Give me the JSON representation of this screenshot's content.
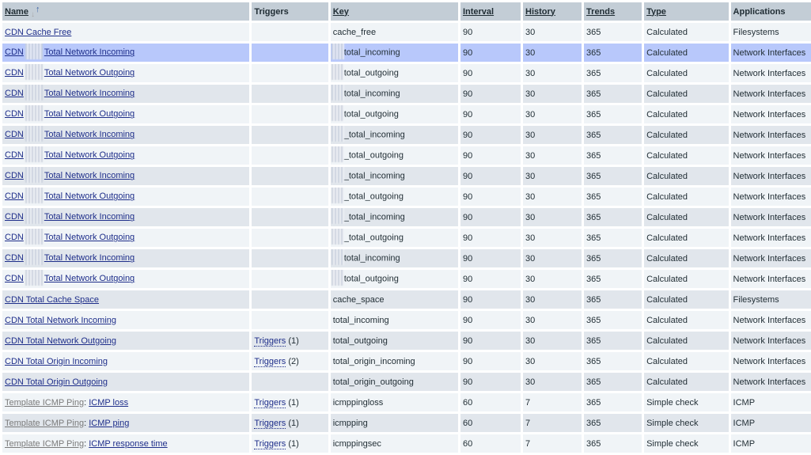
{
  "columns": [
    {
      "label": "Name",
      "sortable": true,
      "sorted": "asc"
    },
    {
      "label": "Triggers",
      "sortable": false
    },
    {
      "label": "Key",
      "sortable": true
    },
    {
      "label": "Interval",
      "sortable": true
    },
    {
      "label": "History",
      "sortable": true
    },
    {
      "label": "Trends",
      "sortable": true
    },
    {
      "label": "Type",
      "sortable": true
    },
    {
      "label": "Applications",
      "sortable": false
    }
  ],
  "icons": {
    "sort_asc": "sort-ascending-arrows-icon"
  },
  "rows": [
    {
      "template": "",
      "name_pre": "CDN Cache Free",
      "redacted": false,
      "name_post": "",
      "triggers": "",
      "trig_count": "",
      "key": "cache_free",
      "key_redacted": false,
      "interval": "90",
      "history": "30",
      "trends": "365",
      "type": "Calculated",
      "app": "Filesystems",
      "highlight": false
    },
    {
      "template": "",
      "name_pre": "CDN",
      "redacted": true,
      "name_post": "Total Network Incoming",
      "triggers": "",
      "trig_count": "",
      "key": "total_incoming",
      "key_redacted": true,
      "interval": "90",
      "history": "30",
      "trends": "365",
      "type": "Calculated",
      "app": "Network Interfaces",
      "highlight": true
    },
    {
      "template": "",
      "name_pre": "CDN",
      "redacted": true,
      "name_post": "Total Network Outgoing",
      "triggers": "",
      "trig_count": "",
      "key": "total_outgoing",
      "key_redacted": true,
      "interval": "90",
      "history": "30",
      "trends": "365",
      "type": "Calculated",
      "app": "Network Interfaces",
      "highlight": false
    },
    {
      "template": "",
      "name_pre": "CDN",
      "redacted": true,
      "name_post": "Total Network Incoming",
      "triggers": "",
      "trig_count": "",
      "key": "total_incoming",
      "key_redacted": true,
      "interval": "90",
      "history": "30",
      "trends": "365",
      "type": "Calculated",
      "app": "Network Interfaces",
      "highlight": false
    },
    {
      "template": "",
      "name_pre": "CDN",
      "redacted": true,
      "name_post": "Total Network Outgoing",
      "triggers": "",
      "trig_count": "",
      "key": "total_outgoing",
      "key_redacted": true,
      "interval": "90",
      "history": "30",
      "trends": "365",
      "type": "Calculated",
      "app": "Network Interfaces",
      "highlight": false
    },
    {
      "template": "",
      "name_pre": "CDN",
      "redacted": true,
      "name_post": "Total Network Incoming",
      "triggers": "",
      "trig_count": "",
      "key": "_total_incoming",
      "key_redacted": true,
      "interval": "90",
      "history": "30",
      "trends": "365",
      "type": "Calculated",
      "app": "Network Interfaces",
      "highlight": false
    },
    {
      "template": "",
      "name_pre": "CDN",
      "redacted": true,
      "name_post": "Total Network Outgoing",
      "triggers": "",
      "trig_count": "",
      "key": "_total_outgoing",
      "key_redacted": true,
      "interval": "90",
      "history": "30",
      "trends": "365",
      "type": "Calculated",
      "app": "Network Interfaces",
      "highlight": false
    },
    {
      "template": "",
      "name_pre": "CDN",
      "redacted": true,
      "name_post": "Total Network Incoming",
      "triggers": "",
      "trig_count": "",
      "key": "_total_incoming",
      "key_redacted": true,
      "interval": "90",
      "history": "30",
      "trends": "365",
      "type": "Calculated",
      "app": "Network Interfaces",
      "highlight": false
    },
    {
      "template": "",
      "name_pre": "CDN",
      "redacted": true,
      "name_post": "Total Network Outgoing",
      "triggers": "",
      "trig_count": "",
      "key": "_total_outgoing",
      "key_redacted": true,
      "interval": "90",
      "history": "30",
      "trends": "365",
      "type": "Calculated",
      "app": "Network Interfaces",
      "highlight": false
    },
    {
      "template": "",
      "name_pre": "CDN",
      "redacted": true,
      "name_post": "Total Network Incoming",
      "triggers": "",
      "trig_count": "",
      "key": "_total_incoming",
      "key_redacted": true,
      "interval": "90",
      "history": "30",
      "trends": "365",
      "type": "Calculated",
      "app": "Network Interfaces",
      "highlight": false
    },
    {
      "template": "",
      "name_pre": "CDN",
      "redacted": true,
      "name_post": "Total Network Outgoing",
      "triggers": "",
      "trig_count": "",
      "key": "_total_outgoing",
      "key_redacted": true,
      "interval": "90",
      "history": "30",
      "trends": "365",
      "type": "Calculated",
      "app": "Network Interfaces",
      "highlight": false
    },
    {
      "template": "",
      "name_pre": "CDN",
      "redacted": true,
      "name_post": "Total Network Incoming",
      "triggers": "",
      "trig_count": "",
      "key": "total_incoming",
      "key_redacted": true,
      "interval": "90",
      "history": "30",
      "trends": "365",
      "type": "Calculated",
      "app": "Network Interfaces",
      "highlight": false
    },
    {
      "template": "",
      "name_pre": "CDN",
      "redacted": true,
      "name_post": "Total Network Outgoing",
      "triggers": "",
      "trig_count": "",
      "key": "total_outgoing",
      "key_redacted": true,
      "interval": "90",
      "history": "30",
      "trends": "365",
      "type": "Calculated",
      "app": "Network Interfaces",
      "highlight": false
    },
    {
      "template": "",
      "name_pre": "CDN Total Cache Space",
      "redacted": false,
      "name_post": "",
      "triggers": "",
      "trig_count": "",
      "key": "cache_space",
      "key_redacted": false,
      "interval": "90",
      "history": "30",
      "trends": "365",
      "type": "Calculated",
      "app": "Filesystems",
      "highlight": false
    },
    {
      "template": "",
      "name_pre": "CDN Total Network Incoming",
      "redacted": false,
      "name_post": "",
      "triggers": "",
      "trig_count": "",
      "key": "total_incoming",
      "key_redacted": false,
      "interval": "90",
      "history": "30",
      "trends": "365",
      "type": "Calculated",
      "app": "Network Interfaces",
      "highlight": false
    },
    {
      "template": "",
      "name_pre": "CDN Total Network Outgoing",
      "redacted": false,
      "name_post": "",
      "triggers": "Triggers",
      "trig_count": "(1)",
      "key": "total_outgoing",
      "key_redacted": false,
      "interval": "90",
      "history": "30",
      "trends": "365",
      "type": "Calculated",
      "app": "Network Interfaces",
      "highlight": false
    },
    {
      "template": "",
      "name_pre": "CDN Total Origin Incoming",
      "redacted": false,
      "name_post": "",
      "triggers": "Triggers",
      "trig_count": "(2)",
      "key": "total_origin_incoming",
      "key_redacted": false,
      "interval": "90",
      "history": "30",
      "trends": "365",
      "type": "Calculated",
      "app": "Network Interfaces",
      "highlight": false
    },
    {
      "template": "",
      "name_pre": "CDN Total Origin Outgoing",
      "redacted": false,
      "name_post": "",
      "triggers": "",
      "trig_count": "",
      "key": "total_origin_outgoing",
      "key_redacted": false,
      "interval": "90",
      "history": "30",
      "trends": "365",
      "type": "Calculated",
      "app": "Network Interfaces",
      "highlight": false
    },
    {
      "template": "Template ICMP Ping",
      "name_pre": "ICMP loss",
      "redacted": false,
      "name_post": "",
      "triggers": "Triggers",
      "trig_count": "(1)",
      "key": "icmppingloss",
      "key_redacted": false,
      "interval": "60",
      "history": "7",
      "trends": "365",
      "type": "Simple check",
      "app": "ICMP",
      "highlight": false
    },
    {
      "template": "Template ICMP Ping",
      "name_pre": "ICMP ping",
      "redacted": false,
      "name_post": "",
      "triggers": "Triggers",
      "trig_count": "(1)",
      "key": "icmpping",
      "key_redacted": false,
      "interval": "60",
      "history": "7",
      "trends": "365",
      "type": "Simple check",
      "app": "ICMP",
      "highlight": false
    },
    {
      "template": "Template ICMP Ping",
      "name_pre": "ICMP response time",
      "redacted": false,
      "name_post": "",
      "triggers": "Triggers",
      "trig_count": "(1)",
      "key": "icmppingsec",
      "key_redacted": false,
      "interval": "60",
      "history": "7",
      "trends": "365",
      "type": "Simple check",
      "app": "ICMP",
      "highlight": false
    }
  ],
  "separator": ": ",
  "colors": {
    "header_bg": "#c3cdd6",
    "row_odd": "#f0f4f7",
    "row_even": "#e1e6ec",
    "row_highlight": "#b8c8fb",
    "link": "#1e2e8a",
    "template_link": "#7a7a7a",
    "sort_arrow": "#3b62a6"
  }
}
